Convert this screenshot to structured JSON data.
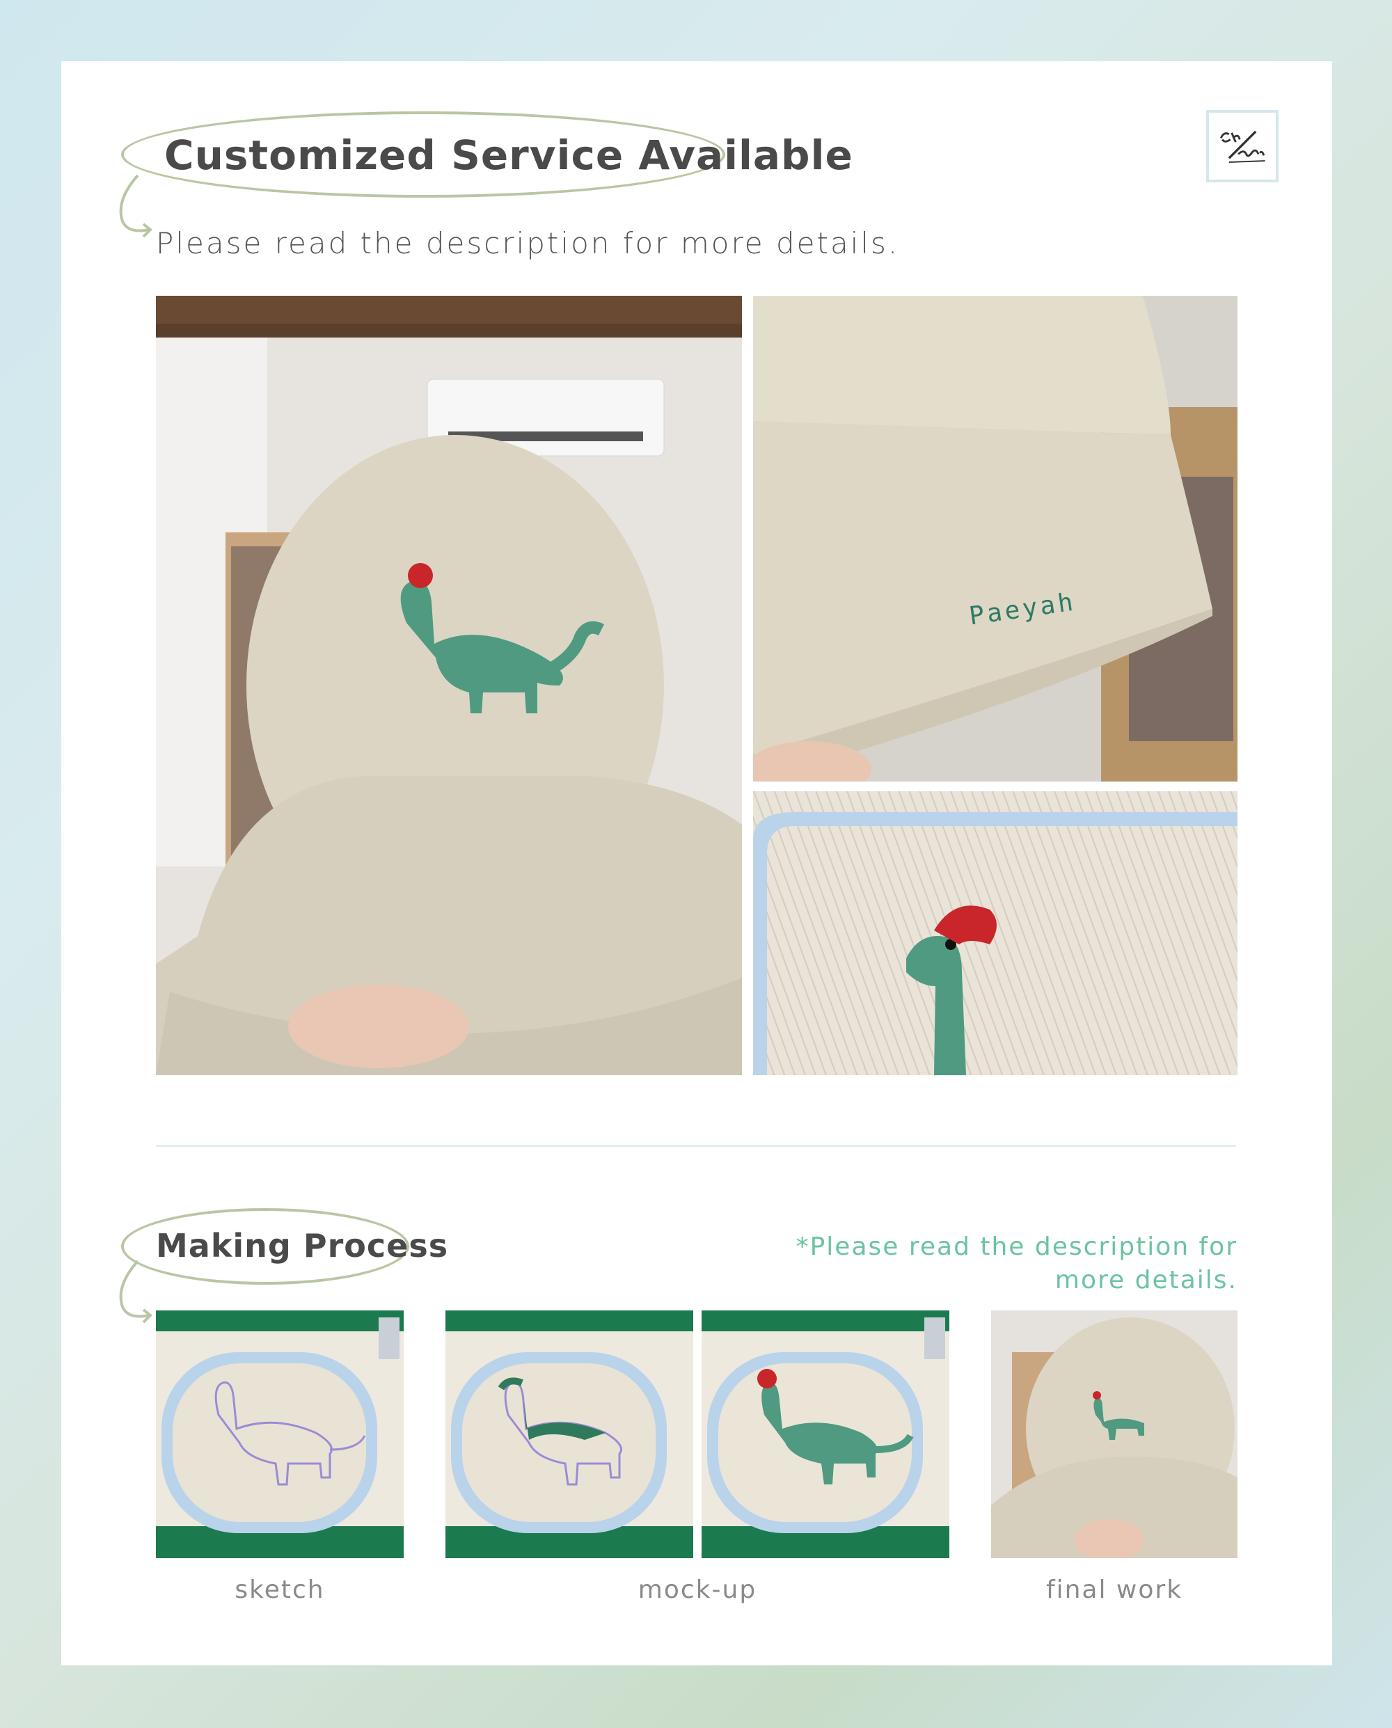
{
  "header": {
    "title": "Customized Service Available",
    "subtitle": "Please read the description for more details."
  },
  "logo": {
    "icon": "chans-signature-logo"
  },
  "gallery": {
    "photos": [
      {
        "name": "hat-front-dinosaur-photo"
      },
      {
        "name": "hat-brim-name-paeyah-photo"
      },
      {
        "name": "embroidery-closeup-photo"
      }
    ],
    "brim_text": "Paeyah"
  },
  "process": {
    "title": "Making Process",
    "note": "*Please read the description for more details.",
    "captions": [
      "sketch",
      "mock-up",
      "final work"
    ]
  },
  "colors": {
    "bubble_outline": "#b9c6a4",
    "note_green": "#6cc3a0",
    "dino_green": "#4f9a80",
    "dino_crest": "#c8262b",
    "hoop_blue": "#b9d3ea",
    "canvas": "#eee9df",
    "mat_green": "#1c7a4f"
  }
}
